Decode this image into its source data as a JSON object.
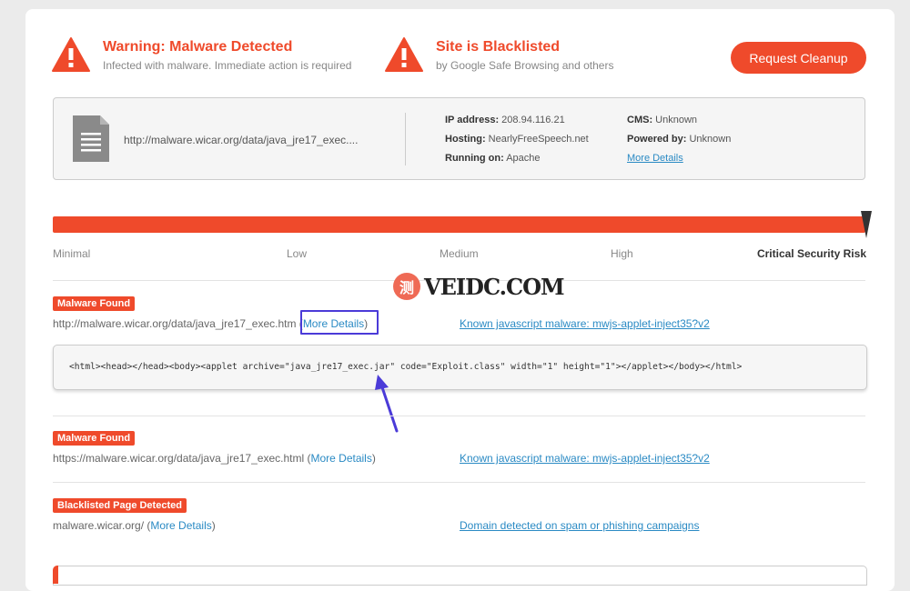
{
  "alerts": [
    {
      "title": "Warning: Malware Detected",
      "subtitle": "Infected with malware. Immediate action is required"
    },
    {
      "title": "Site is Blacklisted",
      "subtitle": "by Google Safe Browsing and others"
    }
  ],
  "cleanup_button": "Request Cleanup",
  "site": {
    "url": "http://malware.wicar.org/data/java_jre17_exec....",
    "ip_label": "IP address:",
    "ip_value": "208.94.116.21",
    "hosting_label": "Hosting:",
    "hosting_value": "NearlyFreeSpeech.net",
    "running_label": "Running on:",
    "running_value": "Apache",
    "cms_label": "CMS:",
    "cms_value": "Unknown",
    "powered_label": "Powered by:",
    "powered_value": "Unknown",
    "more_details": "More Details"
  },
  "risk": {
    "level_fraction": 1.0,
    "labels": [
      "Minimal",
      "Low",
      "Medium",
      "High",
      "Critical Security Risk"
    ]
  },
  "findings": [
    {
      "badge": "Malware Found",
      "url": "http://malware.wicar.org/data/java_jre17_exec.htm",
      "more": "More Details",
      "right_link": "Known javascript malware: mwjs-applet-inject35?v2",
      "code": "<html><head></head><body><applet archive=\"java_jre17_exec.jar\" code=\"Exploit.class\" width=\"1\" height=\"1\"></applet></body></html>"
    },
    {
      "badge": "Malware Found",
      "url": "https://malware.wicar.org/data/java_jre17_exec.html",
      "more": "More Details",
      "right_link": "Known javascript malware: mwjs-applet-inject35?v2"
    },
    {
      "badge": "Blacklisted Page Detected",
      "url": "malware.wicar.org/",
      "more": "More Details",
      "right_link": "Domain detected on spam or phishing campaigns"
    }
  ],
  "watermark": {
    "glyph": "测",
    "text": "VEIDC.COM"
  },
  "colors": {
    "accent": "#ef4a2b",
    "link": "#2a8ac4",
    "annotation": "#4b3bd8"
  }
}
